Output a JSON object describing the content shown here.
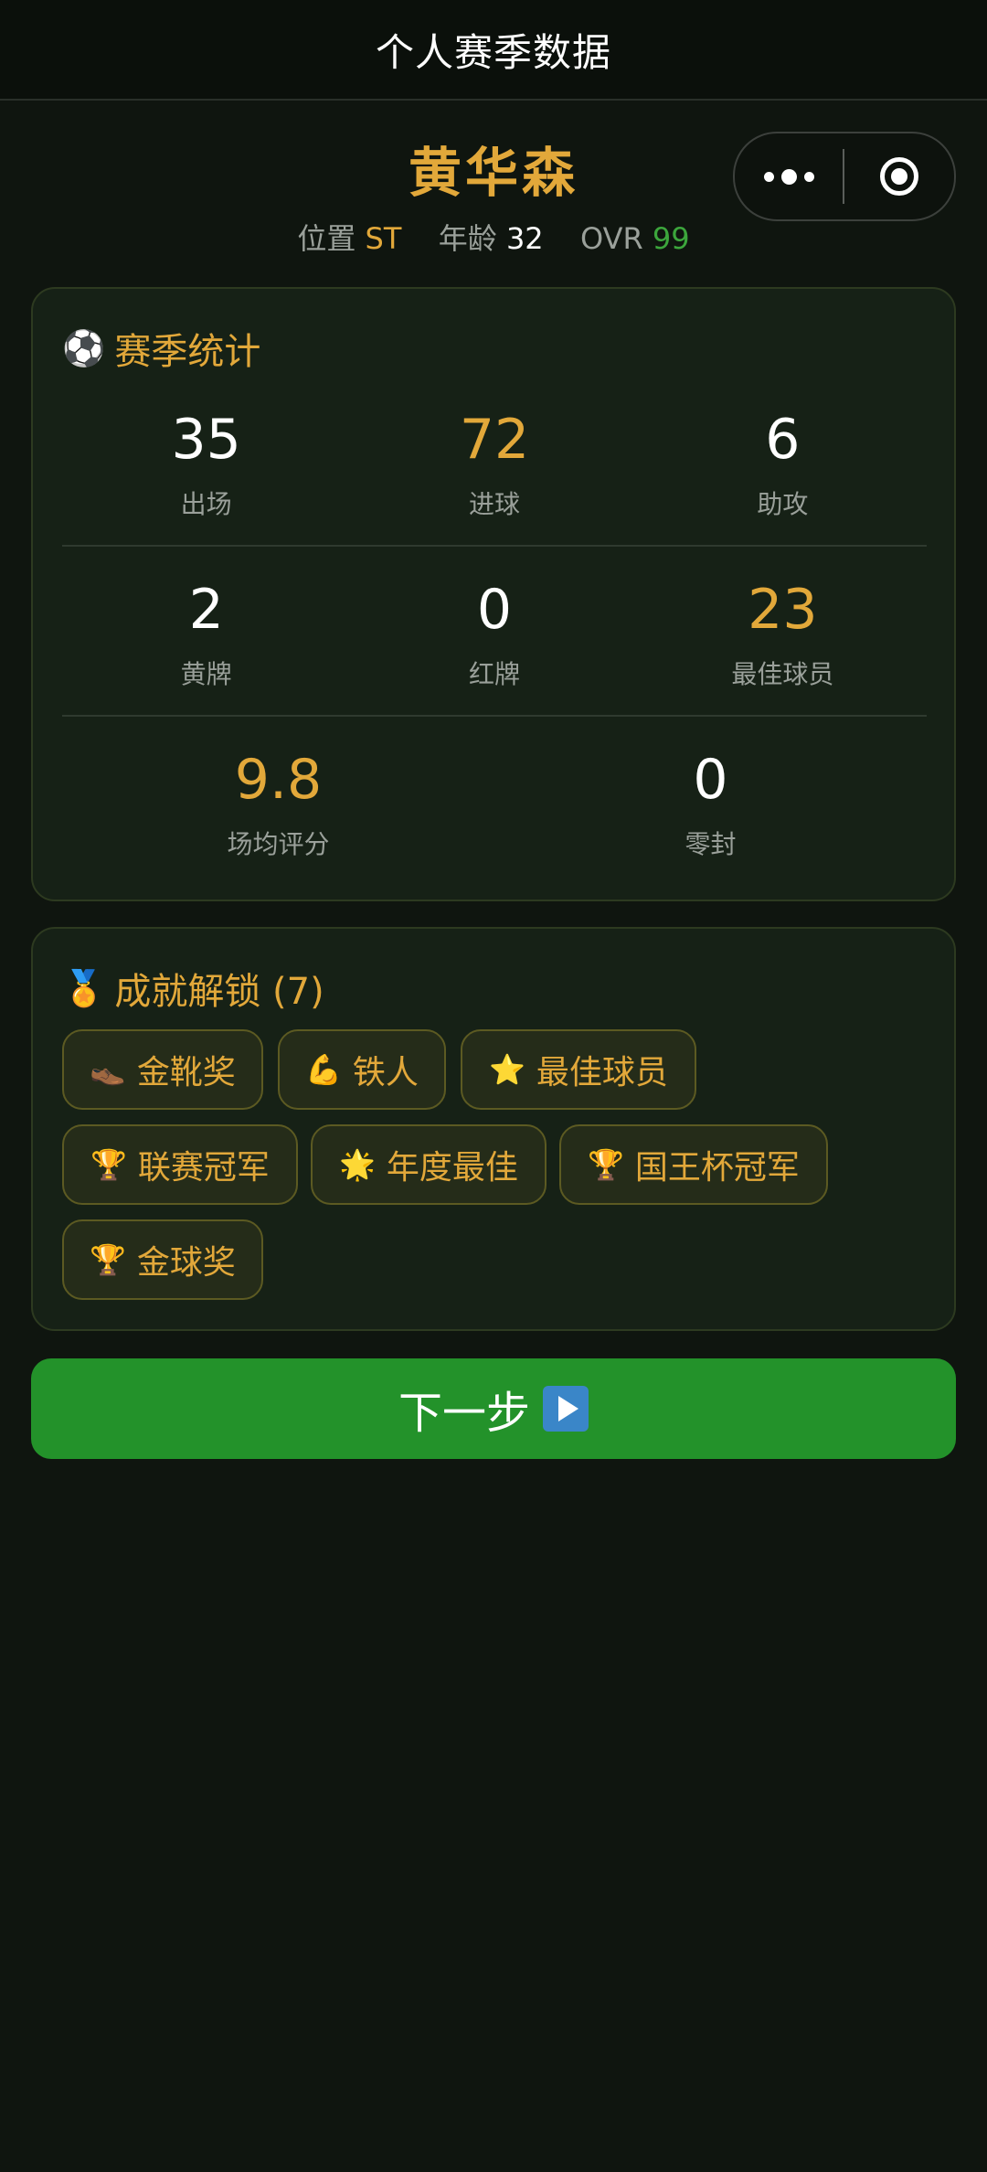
{
  "nav": {
    "title": "个人赛季数据"
  },
  "player": {
    "name": "黄华森",
    "position_label": "位置",
    "position": "ST",
    "age_label": "年龄",
    "age": "32",
    "ovr_label": "OVR",
    "ovr": "99"
  },
  "capsule": {
    "more_icon": "more-dots-icon",
    "close_icon": "target-close-icon"
  },
  "stats": {
    "title_icon": "⚽",
    "title": "赛季统计",
    "items": [
      {
        "value": "35",
        "label": "出场",
        "highlight": false
      },
      {
        "value": "72",
        "label": "进球",
        "highlight": true
      },
      {
        "value": "6",
        "label": "助攻",
        "highlight": false
      },
      {
        "value": "2",
        "label": "黄牌",
        "highlight": false
      },
      {
        "value": "0",
        "label": "红牌",
        "highlight": false
      },
      {
        "value": "23",
        "label": "最佳球员",
        "highlight": true
      },
      {
        "value": "9.8",
        "label": "场均评分",
        "highlight": true
      },
      {
        "value": "0",
        "label": "零封",
        "highlight": false
      }
    ]
  },
  "achievements": {
    "title_icon": "🏅",
    "title": "成就解锁 (7)",
    "badges": [
      {
        "icon": "👞",
        "label": "金靴奖"
      },
      {
        "icon": "💪",
        "label": "铁人"
      },
      {
        "icon": "⭐",
        "label": "最佳球员"
      },
      {
        "icon": "🏆",
        "label": "联赛冠军"
      },
      {
        "icon": "🌟",
        "label": "年度最佳"
      },
      {
        "icon": "🏆",
        "label": "国王杯冠军"
      },
      {
        "icon": "🏆",
        "label": "金球奖"
      }
    ]
  },
  "next_button": {
    "label": "下一步",
    "icon": "▶️"
  },
  "colors": {
    "background": "#0f150f",
    "accent_gold": "#e2a83a",
    "accent_green": "#3ca63c",
    "button_green": "#23922a",
    "card_bg": "#162116"
  }
}
